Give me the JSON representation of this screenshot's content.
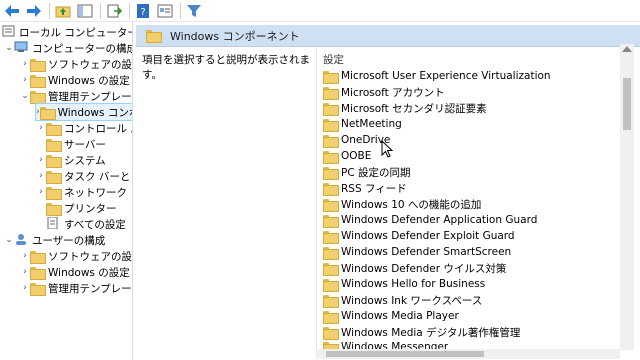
{
  "toolbar": {
    "buttons": [
      "back-icon",
      "forward-icon",
      "up-folder-icon",
      "show-hide-tree-icon",
      "export-list-icon",
      "help-icon",
      "properties-icon",
      "filter-icon"
    ]
  },
  "tree": {
    "root": "ローカル コンピューター ポリシー",
    "computer_config": "コンピューターの構成",
    "cc_software": "ソフトウェアの設定",
    "cc_windows": "Windows の設定",
    "cc_admin": "管理用テンプレート",
    "windows_components": "Windows コンポーネント",
    "control_panel": "コントロール パネル",
    "server": "サーバー",
    "system": "システム",
    "taskbar": "タスク バーと [スタート] メニュー",
    "network": "ネットワーク",
    "printers": "プリンター",
    "all_settings": "すべての設定",
    "user_config": "ユーザーの構成",
    "uc_software": "ソフトウェアの設定",
    "uc_windows": "Windows の設定",
    "uc_admin": "管理用テンプレート"
  },
  "pane": {
    "header": "Windows コンポーネント",
    "description": "項目を選択すると説明が表示されます。",
    "column_header": "設定"
  },
  "items": [
    "Microsoft User Experience Virtualization",
    "Microsoft アカウント",
    "Microsoft セカンダリ認証要素",
    "NetMeeting",
    "OneDrive",
    "OOBE",
    "PC 設定の同期",
    "RSS フィード",
    "Windows 10 への機能の追加",
    "Windows Defender Application Guard",
    "Windows Defender Exploit Guard",
    "Windows Defender SmartScreen",
    "Windows Defender ウイルス対策",
    "Windows Hello for Business",
    "Windows Ink ワークスペース",
    "Windows Media Player",
    "Windows Media デジタル著作権管理",
    "Windows Messenger"
  ],
  "colors": {
    "header_bg": "#cfe0f3",
    "folder": "#f2cf6d",
    "selection": "#e5f1fb"
  }
}
